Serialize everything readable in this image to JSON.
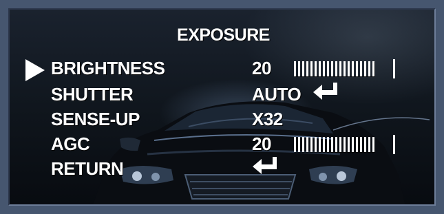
{
  "menu": {
    "title": "EXPOSURE",
    "items": [
      {
        "label": "BRIGHTNESS",
        "value": "20",
        "control": "level-bar",
        "level": 20
      },
      {
        "label": "SHUTTER",
        "value": "AUTO",
        "control": "enter-icon"
      },
      {
        "label": "SENSE-UP",
        "value": "X32",
        "control": "none"
      },
      {
        "label": "AGC",
        "value": "20",
        "control": "level-bar",
        "level": 20
      },
      {
        "label": "RETURN",
        "value": "",
        "control": "enter-icon"
      }
    ],
    "selected_index": 0,
    "cursor_icon": "play-triangle-icon",
    "enter_icon": "enter-return-icon"
  },
  "colors": {
    "osd_text": "#ffffff",
    "outer_background": "#46566f"
  }
}
